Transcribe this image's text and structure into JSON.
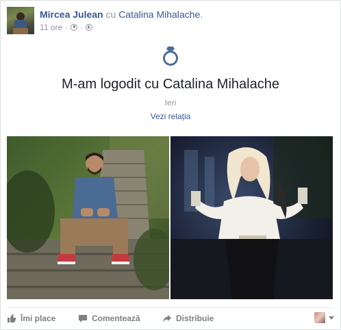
{
  "post": {
    "author": "Mircea Julean",
    "with_word": "cu",
    "tagged": "Catalina Mihalache",
    "tagged_suffix": ".",
    "time": "11 ore",
    "separator": "·",
    "audience_icon": "globe-icon",
    "clock_icon": "clock-icon"
  },
  "event": {
    "icon": "ring-icon",
    "title": "M-am logodit cu Catalina Mihalache",
    "date": "Ieri",
    "link": "Vezi relația"
  },
  "photos": [
    {
      "name": "photo-man-on-steps"
    },
    {
      "name": "photo-woman-night"
    }
  ],
  "actions": {
    "like": "Îmi place",
    "comment": "Comentează",
    "share": "Distribuie"
  },
  "colors": {
    "link": "#365899",
    "muted": "#90949c",
    "text": "#1d2129",
    "action": "#7f7f7f",
    "ring": "#4b6e9b"
  }
}
